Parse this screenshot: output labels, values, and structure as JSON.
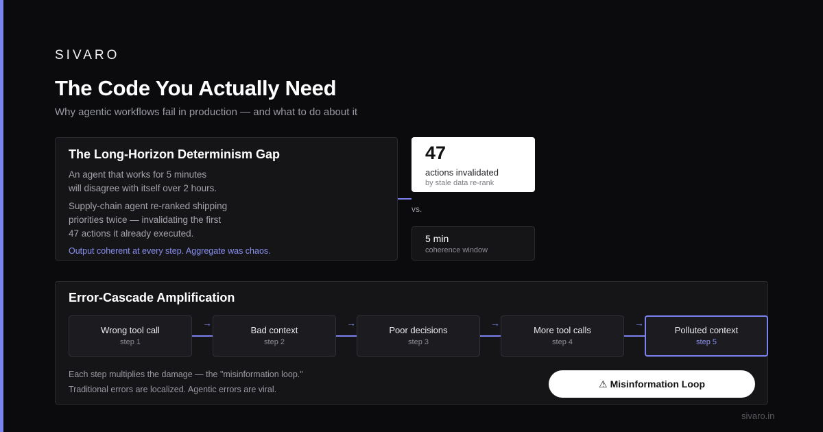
{
  "brand": "SIVARO",
  "title": "The Code You Actually Need",
  "subtitle": "Why agentic workflows fail in production — and what to do about it",
  "gap_card": {
    "title": "The Long-Horizon Determinism Gap",
    "line1": "An agent that works for 5 minutes",
    "line2": "will disagree with itself over 2 hours.",
    "line3": "Supply-chain agent re-ranked shipping",
    "line4": "priorities twice — invalidating the first",
    "line5": "47 actions it already executed.",
    "accent": "Output coherent at every step. Aggregate was chaos."
  },
  "stat": {
    "value": "47",
    "label": "actions invalidated",
    "sub": "by stale data re-rank"
  },
  "vs": "vs.",
  "window": {
    "value": "5 min",
    "sub": "coherence window"
  },
  "cascade": {
    "title": "Error-Cascade Amplification",
    "arrow_glyph": "→",
    "steps": [
      {
        "title": "Wrong tool call",
        "num": "step 1"
      },
      {
        "title": "Bad context",
        "num": "step 2"
      },
      {
        "title": "Poor decisions",
        "num": "step 3"
      },
      {
        "title": "More tool calls",
        "num": "step 4"
      },
      {
        "title": "Polluted context",
        "num": "step 5"
      }
    ],
    "note1": "Each step multiplies the damage — the \"misinformation loop.\"",
    "note2": "Traditional errors are localized. Agentic errors are viral.",
    "button_icon": "⚠",
    "button_label": "Misinformation Loop"
  },
  "footer_url": "sivaro.in",
  "colors": {
    "accent": "#7b83f0",
    "background": "#0b0b0d",
    "card": "#151518"
  }
}
